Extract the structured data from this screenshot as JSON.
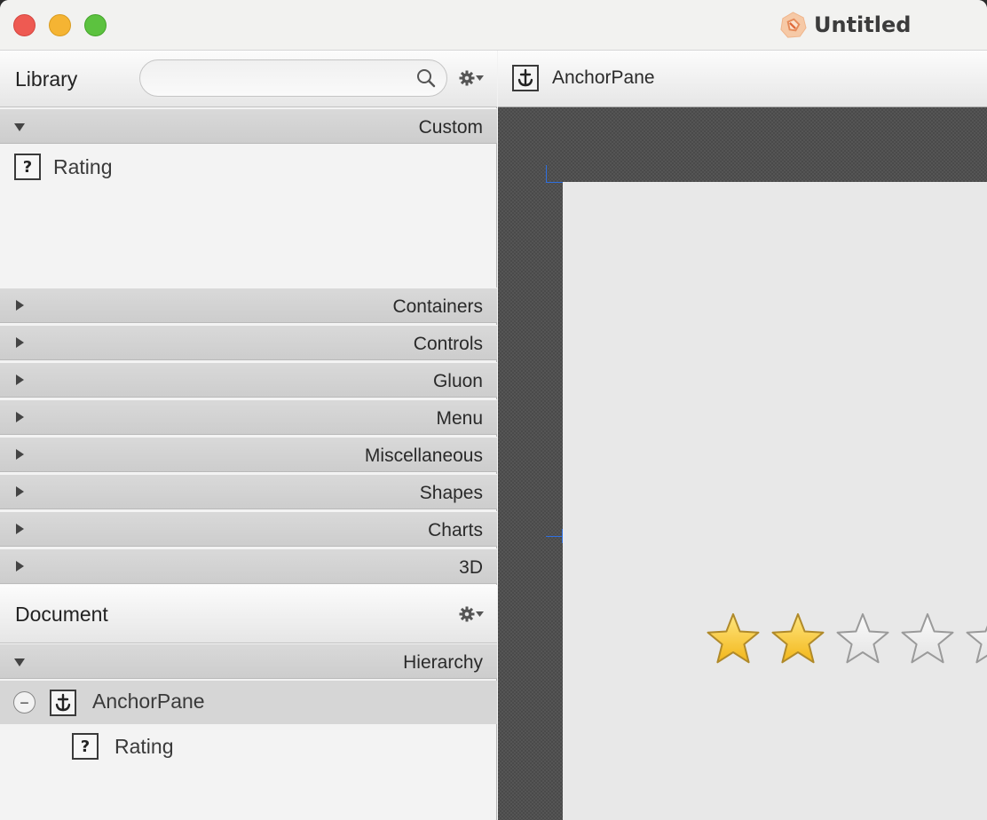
{
  "window": {
    "title": "Untitled"
  },
  "library": {
    "title": "Library",
    "search": {
      "value": "",
      "placeholder": ""
    },
    "sections": [
      {
        "label": "Custom",
        "expanded": true,
        "items": [
          {
            "label": "Rating",
            "icon": "question-icon"
          }
        ]
      },
      {
        "label": "Containers",
        "expanded": false
      },
      {
        "label": "Controls",
        "expanded": false
      },
      {
        "label": "Gluon",
        "expanded": false
      },
      {
        "label": "Menu",
        "expanded": false
      },
      {
        "label": "Miscellaneous",
        "expanded": false
      },
      {
        "label": "Shapes",
        "expanded": false
      },
      {
        "label": "Charts",
        "expanded": false
      },
      {
        "label": "3D",
        "expanded": false
      }
    ]
  },
  "document": {
    "title": "Document",
    "section": {
      "label": "Hierarchy",
      "expanded": true
    },
    "tree": [
      {
        "label": "AnchorPane",
        "icon": "anchor-icon",
        "selected": true,
        "expanded": true,
        "children": [
          {
            "label": "Rating",
            "icon": "question-icon"
          }
        ]
      }
    ]
  },
  "content": {
    "breadcrumb": "AnchorPane",
    "rating": {
      "value": 2,
      "max": 5
    }
  },
  "colors": {
    "star_filled": "#f2b619",
    "star_empty": "#e3e3e3",
    "guide": "#2e6fe0",
    "selection": "#d6d6d6"
  }
}
